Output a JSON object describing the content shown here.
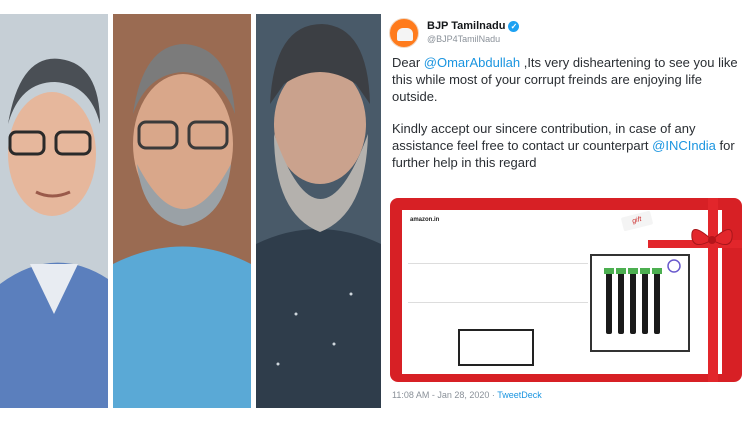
{
  "tweet": {
    "author_name": "BJP Tamilnadu",
    "handle": "@BJP4TamilNadu",
    "paragraph1": {
      "prefix": "Dear ",
      "mention": "@OmarAbdullah",
      "rest": " ,Its very disheartening to see you like this while most of your corrupt freinds are enjoying life outside."
    },
    "paragraph2": {
      "prefix": "Kindly accept our sincere contribution, in case of any assistance feel free to contact ur counterpart ",
      "mention": "@INCIndia",
      "rest": " for further help in this regard"
    },
    "embed": {
      "brand": "amazon.in",
      "tag_text": "gift"
    },
    "timestamp": "11:08 AM - Jan 28, 2020",
    "separator": " · ",
    "source": "TweetDeck"
  },
  "colors": {
    "mention": "#1b95e0",
    "embed_background": "#d72025",
    "avatar": "#ff7b1c"
  },
  "icons": [
    "verified-badge-icon",
    "bjp-logo-icon",
    "gift-bow-icon",
    "razor-icon"
  ]
}
